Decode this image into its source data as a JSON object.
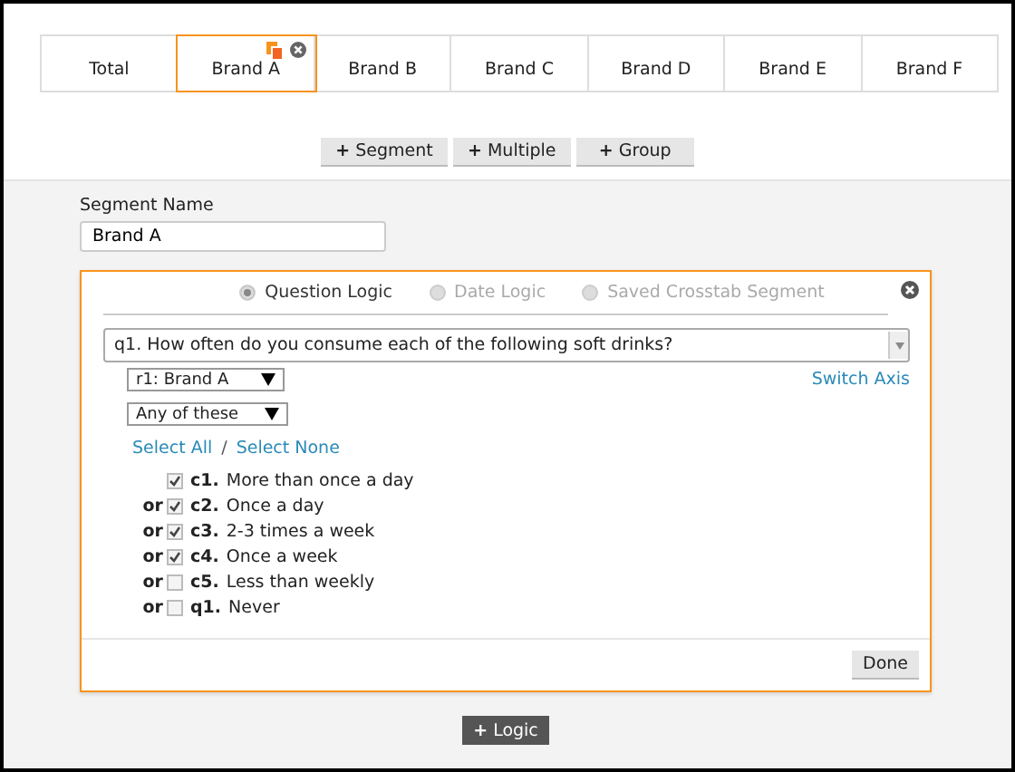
{
  "tabs": [
    {
      "label": "Total",
      "selected": false
    },
    {
      "label": "Brand A",
      "selected": true
    },
    {
      "label": "Brand B",
      "selected": false
    },
    {
      "label": "Brand C",
      "selected": false
    },
    {
      "label": "Brand D",
      "selected": false
    },
    {
      "label": "Brand E",
      "selected": false
    },
    {
      "label": "Brand F",
      "selected": false
    }
  ],
  "add_buttons": [
    {
      "icon": "+",
      "label": "Segment"
    },
    {
      "icon": "+",
      "label": "Multiple"
    },
    {
      "icon": "+",
      "label": "Group"
    }
  ],
  "segment_name": {
    "label": "Segment Name",
    "value": "Brand A"
  },
  "logic_panel": {
    "modes": [
      {
        "label": "Question Logic",
        "selected": true,
        "disabled": false
      },
      {
        "label": "Date Logic",
        "selected": false,
        "disabled": true
      },
      {
        "label": "Saved Crosstab Segment",
        "selected": false,
        "disabled": true
      }
    ],
    "question": "q1. How often do you consume each of the following soft drinks?",
    "switch_axis": "Switch Axis",
    "row_select": "r1: Brand A",
    "match_select": "Any of these",
    "select_all": "Select All",
    "separator": "/",
    "select_none": "Select None",
    "options": [
      {
        "code": "c1.",
        "label": "More than once a day",
        "checked": true
      },
      {
        "prefix": "or",
        "code": "c2.",
        "label": "Once a day",
        "checked": true
      },
      {
        "prefix": "or",
        "code": "c3.",
        "label": "2-3 times a week",
        "checked": true
      },
      {
        "prefix": "or",
        "code": "c4.",
        "label": "Once a week",
        "checked": true
      },
      {
        "prefix": "or",
        "code": "c5.",
        "label": "Less than weekly",
        "checked": false
      },
      {
        "prefix": "or",
        "code": "q1.",
        "label": "Never",
        "checked": false
      }
    ],
    "done": "Done"
  },
  "add_logic": {
    "icon": "+",
    "label": "Logic"
  }
}
